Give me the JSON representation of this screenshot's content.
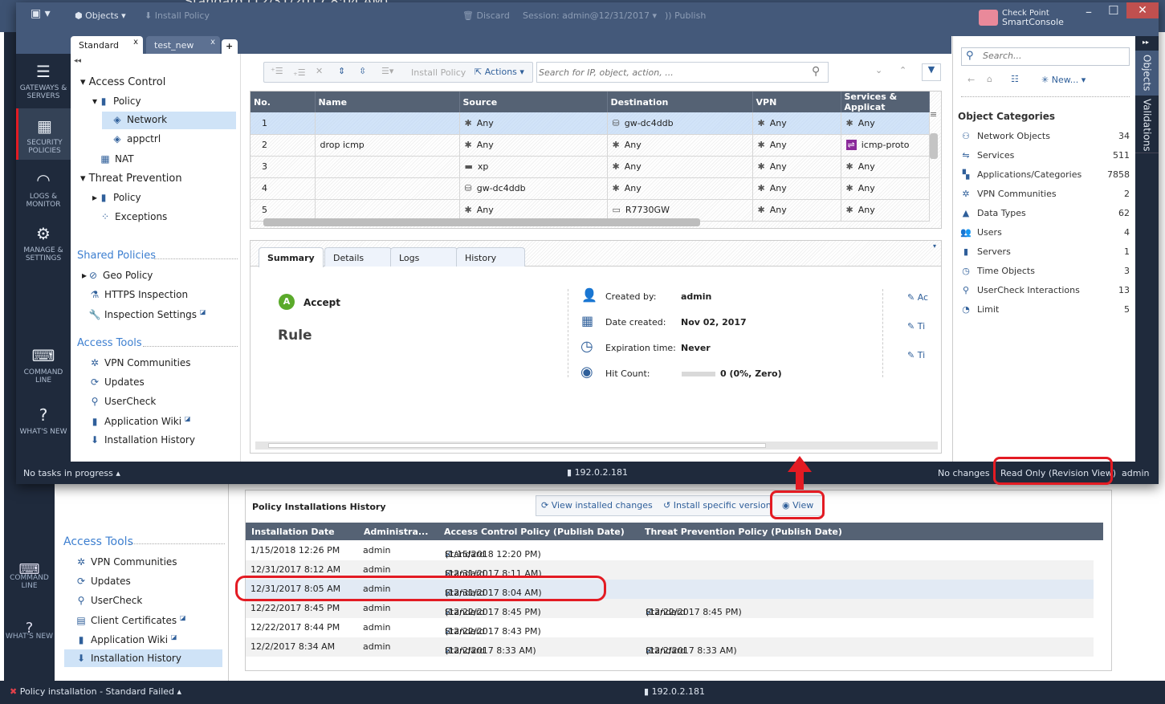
{
  "background_window": {
    "title": "Standard (12/31/2017 8:04 AM)",
    "nav": [
      {
        "label": "COMMAND LINE"
      },
      {
        "label": "WHAT'S NEW"
      }
    ],
    "access_tools": {
      "title": "Access Tools",
      "items": [
        {
          "label": "VPN Communities",
          "icon": "vpn-communities-icon"
        },
        {
          "label": "Updates",
          "icon": "updates-icon"
        },
        {
          "label": "UserCheck",
          "icon": "usercheck-icon"
        },
        {
          "label": "Client Certificates",
          "icon": "client-certificates-icon",
          "external": true
        },
        {
          "label": "Application Wiki",
          "icon": "application-wiki-icon",
          "external": true
        },
        {
          "label": "Installation History",
          "icon": "installation-history-icon",
          "selected": true
        }
      ]
    },
    "history": {
      "title": "Policy Installations History",
      "buttons": {
        "view_changes": "View installed changes",
        "install_version": "Install specific version",
        "view": "View"
      },
      "columns": [
        "Installation Date",
        "Administra...",
        "Access Control Policy (Publish Date)",
        "Threat Prevention Policy (Publish Date)"
      ],
      "rows": [
        {
          "date": "1/15/2018 12:26 PM",
          "admin": "admin",
          "access": "Standard",
          "access_date": "(1/15/2018 12:20 PM)",
          "threat": "",
          "threat_date": ""
        },
        {
          "date": "12/31/2017 8:12 AM",
          "admin": "admin",
          "access": "Standard",
          "access_date": "(12/31/2017 8:11 AM)",
          "threat": "",
          "threat_date": ""
        },
        {
          "date": "12/31/2017 8:05 AM",
          "admin": "admin",
          "access": "Standard",
          "access_date": "(12/31/2017 8:04 AM)",
          "threat": "",
          "threat_date": "",
          "selected": true
        },
        {
          "date": "12/22/2017 8:45 PM",
          "admin": "admin",
          "access": "Standard",
          "access_date": "(12/22/2017 8:45 PM)",
          "threat": "Standard",
          "threat_date": "(12/22/2017 8:45 PM)"
        },
        {
          "date": "12/22/2017 8:44 PM",
          "admin": "admin",
          "access": "Standard",
          "access_date": "(12/22/2017 8:43 PM)",
          "threat": "",
          "threat_date": ""
        },
        {
          "date": "12/2/2017 8:34 AM",
          "admin": "admin",
          "access": "Standard",
          "access_date": "(12/2/2017 8:33 AM)",
          "threat": "Standard",
          "threat_date": "(12/2/2017 8:33 AM)"
        }
      ]
    },
    "status": {
      "left": "Policy installation - Standard Failed",
      "server": "192.0.2.181"
    }
  },
  "window": {
    "toolbar": {
      "objects": "Objects",
      "install_policy": "Install Policy",
      "discard": "Discard",
      "session": "Session: admin@12/31/2017",
      "publish": "Publish"
    },
    "brand": {
      "line1": "Check Point",
      "line2": "SmartConsole"
    },
    "tabs": [
      {
        "label": "Standard",
        "active": true
      },
      {
        "label": "test_new",
        "active": false
      }
    ],
    "nav": [
      {
        "label": "GATEWAYS & SERVERS",
        "icon": "gateways-icon"
      },
      {
        "label": "SECURITY POLICIES",
        "icon": "security-policies-icon",
        "active": true
      },
      {
        "label": "LOGS & MONITOR",
        "icon": "logs-monitor-icon"
      },
      {
        "label": "MANAGE & SETTINGS",
        "icon": "gear-icon"
      },
      {
        "label": "COMMAND LINE",
        "icon": "command-line-icon"
      },
      {
        "label": "WHAT'S NEW",
        "icon": "help-icon"
      }
    ],
    "tree": {
      "access_control": "Access Control",
      "policy": "Policy",
      "network": "Network",
      "appctrl": "appctrl",
      "nat": "NAT",
      "threat_prevention": "Threat Prevention",
      "tp_policy": "Policy",
      "exceptions": "Exceptions",
      "shared_policies": "Shared Policies",
      "geo_policy": "Geo Policy",
      "https_inspection": "HTTPS Inspection",
      "inspection_settings": "Inspection Settings",
      "access_tools": "Access Tools",
      "vpn": "VPN Communities",
      "updates": "Updates",
      "usercheck": "UserCheck",
      "app_wiki": "Application Wiki",
      "install_history": "Installation History"
    },
    "rulebar": {
      "install_policy": "Install Policy",
      "actions": "Actions",
      "search_placeholder": "Search for IP, object, action, ..."
    },
    "rules": {
      "columns": [
        "No.",
        "Name",
        "Source",
        "Destination",
        "VPN",
        "Services & Applicat"
      ],
      "rows": [
        {
          "no": "1",
          "name": "",
          "source": "Any",
          "destination": "gw-dc4ddb",
          "vpn": "Any",
          "services": "Any",
          "selected": true
        },
        {
          "no": "2",
          "name": "drop icmp",
          "source": "Any",
          "destination": "Any",
          "vpn": "Any",
          "services": "icmp-proto"
        },
        {
          "no": "3",
          "name": "",
          "source": "xp",
          "destination": "Any",
          "vpn": "Any",
          "services": "Any"
        },
        {
          "no": "4",
          "name": "",
          "source": "gw-dc4ddb",
          "destination": "Any",
          "vpn": "Any",
          "services": "Any"
        },
        {
          "no": "5",
          "name": "",
          "source": "Any",
          "destination": "R7730GW",
          "vpn": "Any",
          "services": "Any"
        }
      ]
    },
    "summary": {
      "tabs": [
        "Summary",
        "Details",
        "Logs",
        "History"
      ],
      "action": "Accept",
      "type": "Rule",
      "created_by_label": "Created by:",
      "created_by": "admin",
      "date_created_label": "Date created:",
      "date_created": "Nov 02, 2017",
      "expiration_label": "Expiration time:",
      "expiration": "Never",
      "hit_count_label": "Hit Count:",
      "hit_count": "0 (0%, Zero)",
      "hit_count_fraction": 0,
      "notes": [
        "Ac",
        "Ti",
        "Ti"
      ]
    },
    "objects": {
      "search_placeholder": "Search...",
      "new_label": "New...",
      "title": "Object Categories",
      "categories": [
        {
          "label": "Network Objects",
          "count": "34",
          "icon": "network-objects-icon"
        },
        {
          "label": "Services",
          "count": "511",
          "icon": "services-icon"
        },
        {
          "label": "Applications/Categories",
          "count": "7858",
          "icon": "applications-icon"
        },
        {
          "label": "VPN Communities",
          "count": "2",
          "icon": "vpn-communities-icon"
        },
        {
          "label": "Data Types",
          "count": "62",
          "icon": "data-types-icon"
        },
        {
          "label": "Users",
          "count": "4",
          "icon": "users-icon"
        },
        {
          "label": "Servers",
          "count": "1",
          "icon": "servers-icon"
        },
        {
          "label": "Time Objects",
          "count": "3",
          "icon": "time-objects-icon"
        },
        {
          "label": "UserCheck Interactions",
          "count": "13",
          "icon": "usercheck-icon"
        },
        {
          "label": "Limit",
          "count": "5",
          "icon": "limit-icon"
        }
      ],
      "vtabs": [
        "Objects",
        "Validations"
      ]
    },
    "status": {
      "tasks": "No tasks in progress",
      "server": "192.0.2.181",
      "changes": "No changes",
      "mode": "Read Only (Revision View)",
      "user": "admin"
    }
  },
  "colors": {
    "titlebar": "#44597a",
    "nav": "#1f2a3c",
    "accent": "#3d7fd0",
    "highlight": "#e31b23",
    "accept": "#5aaa2a"
  }
}
